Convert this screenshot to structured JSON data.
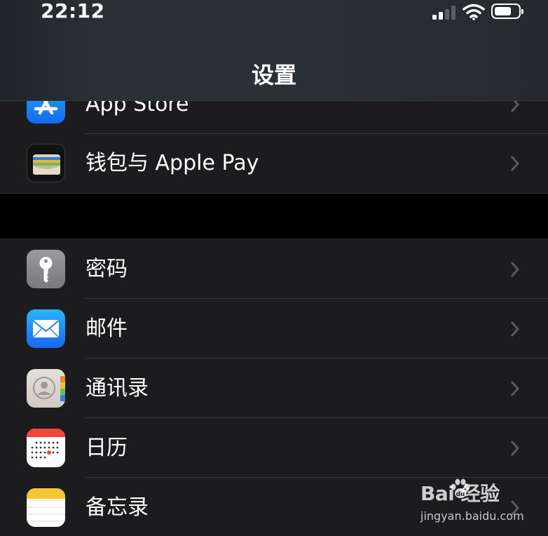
{
  "status_bar": {
    "time": "22:12",
    "signal_bars_active": 2,
    "signal_bars_total": 4,
    "battery_level": 0.75
  },
  "nav": {
    "title": "设置"
  },
  "groups": [
    {
      "items": [
        {
          "label": "App Store",
          "icon": "app-store-icon",
          "icon_color": "#1a8cff"
        },
        {
          "label": "钱包与 Apple Pay",
          "icon": "wallet-icon",
          "icon_color": "#1c1c1e"
        }
      ]
    },
    {
      "items": [
        {
          "label": "密码",
          "icon": "key-icon",
          "icon_color": "#8e8e93"
        },
        {
          "label": "邮件",
          "icon": "mail-icon",
          "icon_color": "#1e8bf5"
        },
        {
          "label": "通讯录",
          "icon": "contacts-icon",
          "icon_color": "#d9d6d0"
        },
        {
          "label": "日历",
          "icon": "calendar-icon",
          "icon_color": "#ffffff"
        },
        {
          "label": "备忘录",
          "icon": "notes-icon",
          "icon_color": "#ffffff"
        }
      ]
    }
  ],
  "watermark": {
    "brand": "Bai  经验",
    "url": "jingyan.baidu.com"
  },
  "colors": {
    "background": "#1c1c1e",
    "separator": "#38383a",
    "chevron": "#5a5a5e",
    "group_gap": "#000000"
  }
}
